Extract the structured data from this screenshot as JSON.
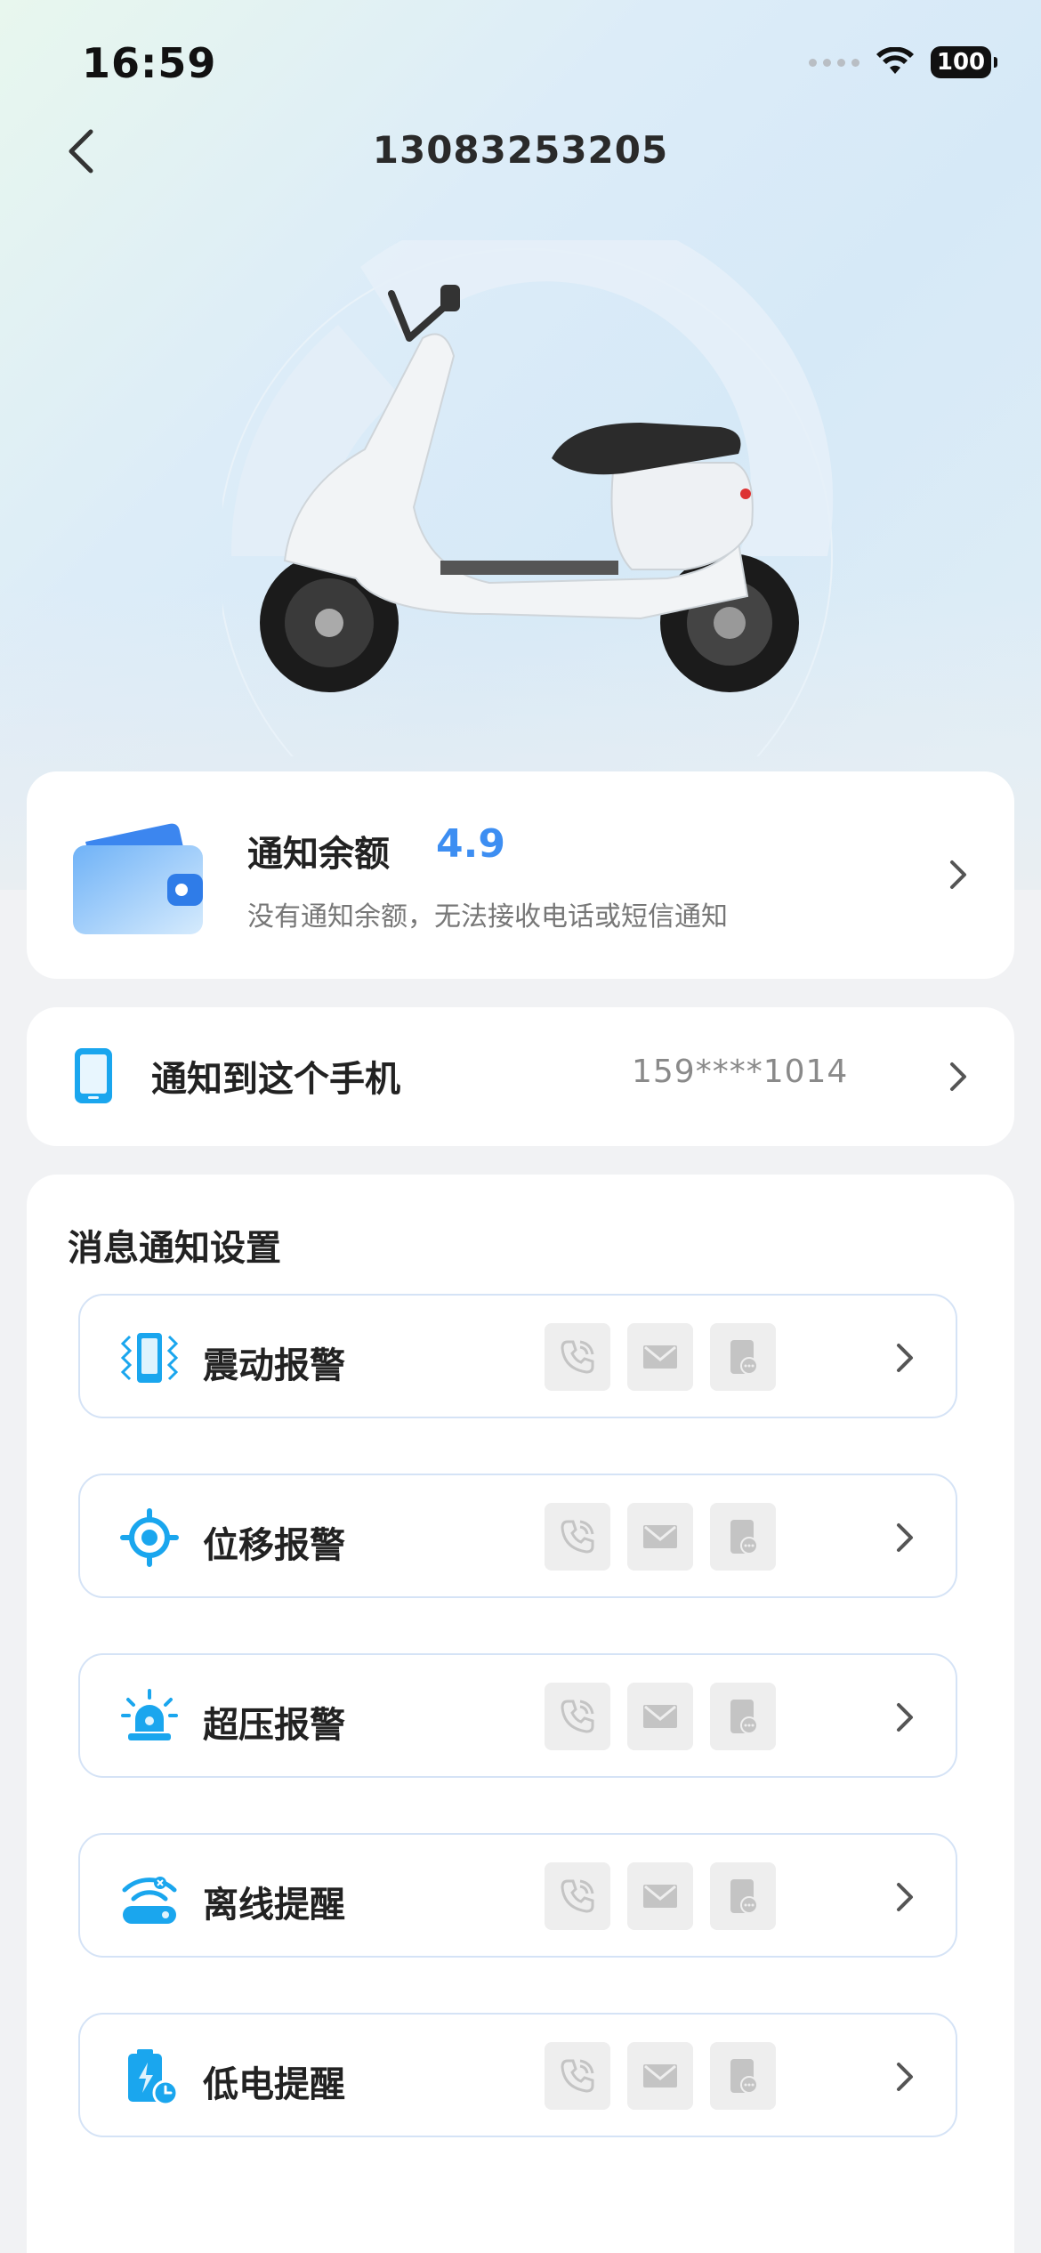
{
  "status_bar": {
    "time": "16:59",
    "battery": "100"
  },
  "nav": {
    "title": "13083253205"
  },
  "balance_card": {
    "title": "通知余额",
    "value": "4.9",
    "description": "没有通知余额，无法接收电话或短信通知"
  },
  "phone_card": {
    "label": "通知到这个手机",
    "number": "159****1014"
  },
  "settings": {
    "title": "消息通知设置",
    "items": [
      {
        "label": "震动报警",
        "icon": "vibration-icon"
      },
      {
        "label": "位移报警",
        "icon": "location-target-icon"
      },
      {
        "label": "超压报警",
        "icon": "siren-icon"
      },
      {
        "label": "离线提醒",
        "icon": "offline-wifi-icon"
      },
      {
        "label": "低电提醒",
        "icon": "low-battery-icon"
      }
    ],
    "channel_icons": [
      "phone-call-icon",
      "sms-icon",
      "app-push-icon"
    ]
  },
  "colors": {
    "accent": "#3d8ef2",
    "icon_blue": "#1aa6ee",
    "row_border": "#d5e3f6"
  }
}
